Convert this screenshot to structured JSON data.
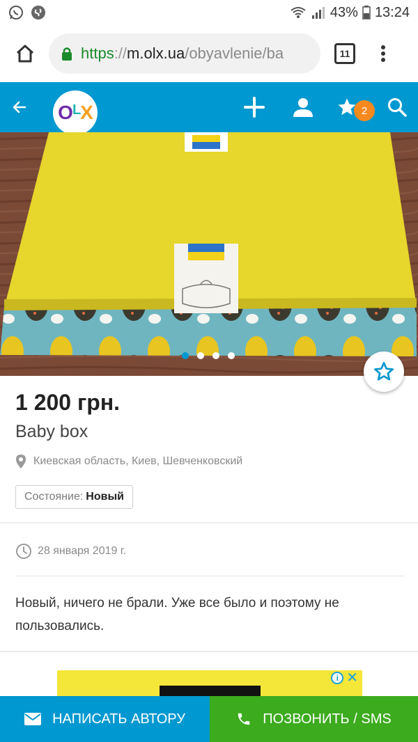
{
  "status_bar": {
    "battery": "43%",
    "time": "13:24",
    "left_icons": [
      "whatsapp-icon",
      "shazam-icon"
    ],
    "right_icons": [
      "wifi-icon",
      "signal-icon",
      "battery-icon"
    ]
  },
  "browser": {
    "url_scheme": "https",
    "url_separator": "://",
    "url_host": "m.olx.ua",
    "url_path": "/obyavlenie/ba",
    "tab_count": "11"
  },
  "header": {
    "logo_o": "O",
    "logo_l": "L",
    "logo_x": "X",
    "favorites_count": "2",
    "accent_color": "#0098d0",
    "badge_color": "#f7891f"
  },
  "gallery": {
    "dots": 4,
    "active_index": 0
  },
  "listing": {
    "price": "1 200 грн.",
    "title": "Baby box",
    "location": "Киевская область, Киев, Шевченковский",
    "condition_label": "Состояние:",
    "condition_value": "Новый",
    "date": "28 января 2019 г.",
    "description": "Новый, ничего не брали. Уже все было и поэтому не пользовались."
  },
  "ad": {
    "info_glyph": "i",
    "close_glyph": "✕"
  },
  "actions": {
    "message_label": "НАПИСАТЬ АВТОРУ",
    "call_label": "ПОЗВОНИТЬ / SMS",
    "message_color": "#0098d0",
    "call_color": "#3cab1e"
  }
}
